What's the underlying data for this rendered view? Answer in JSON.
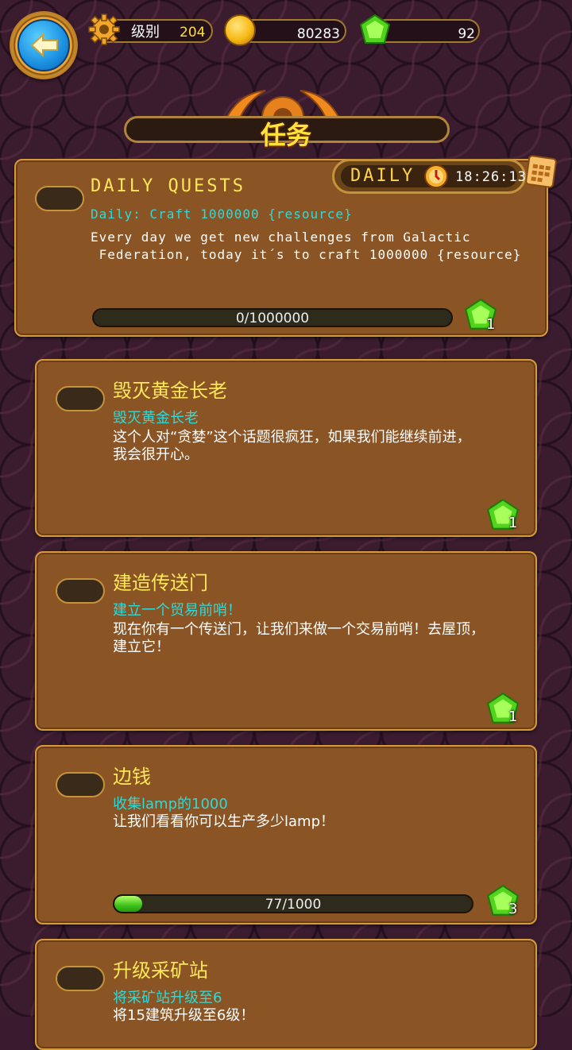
{
  "topbar": {
    "level_label": "级别",
    "level_value": "204",
    "coins": "80283",
    "gems": "92"
  },
  "screen_title": "任务",
  "daily": {
    "tag": "DAILY",
    "timer": "18:26:13",
    "title": "DAILY QUESTS",
    "subtitle": "Daily: Craft 1000000 {resource}",
    "description": "Every day we get new challenges from Galactic\n Federation, today it´s to craft 1000000 {resource}",
    "progress_text": "0/1000000",
    "progress": 0,
    "reward": "1"
  },
  "quests": [
    {
      "title": "毁灭黄金长老",
      "subtitle": "毁灭黄金长老",
      "description": "这个人对“贪婪”这个话题很疯狂，如果我们能继续前进，\n我会很开心。",
      "reward": "1"
    },
    {
      "title": "建造传送门",
      "subtitle": "建立一个贸易前哨！",
      "description": "现在你有一个传送门，让我们来做一个交易前哨！去屋顶，\n建立它！",
      "reward": "1"
    },
    {
      "title": "边钱",
      "subtitle": "收集lamp的1000",
      "description": "让我们看看你可以生产多少lamp！",
      "progress_text": "77/1000",
      "progress": 0.077,
      "reward": "3"
    },
    {
      "title": "升级采矿站",
      "subtitle": "将采矿站升级至6",
      "description": "将15建筑升级至6级！"
    }
  ],
  "colors": {
    "gem": "#5fdc2a",
    "title_yellow": "#ffe75a",
    "subtitle_cyan": "#32d9d6",
    "card_brown": "#8a5424"
  }
}
